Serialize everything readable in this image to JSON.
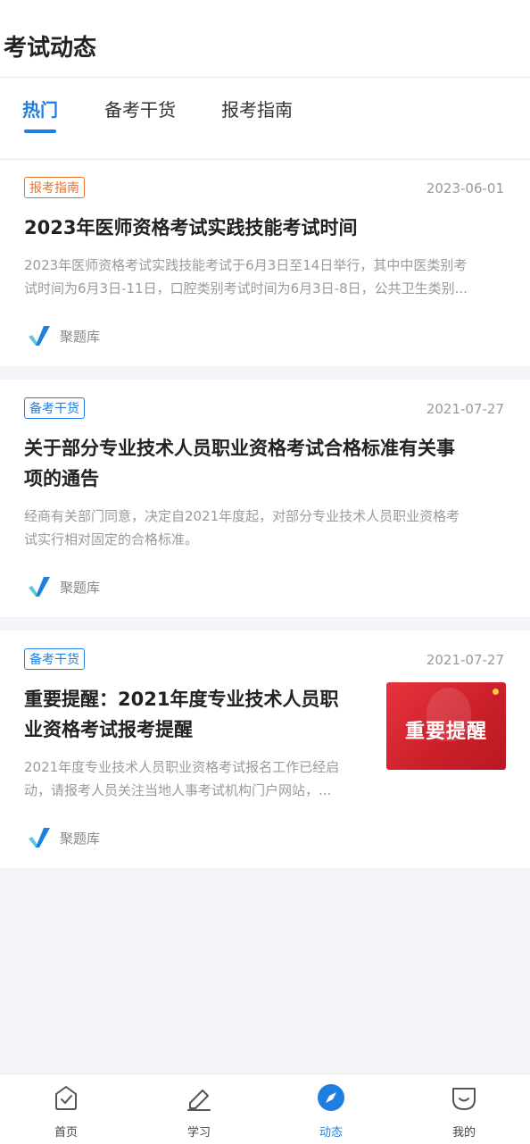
{
  "header": {
    "title": "考试动态"
  },
  "tabs": [
    {
      "label": "热门",
      "active": true
    },
    {
      "label": "备考干货",
      "active": false
    },
    {
      "label": "报考指南",
      "active": false
    }
  ],
  "articles": [
    {
      "tag": "报考指南",
      "date": "2023-06-01",
      "title": "2023年医师资格考试实践技能考试时间",
      "summary_line1": "2023年医师资格考试实践技能考试于6月3日至14日举行，其中中医类别考",
      "summary_line2": "试时间为6月3日-11日，口腔类别考试时间为6月3日-8日，公共卫生类别...",
      "source": "聚题库"
    },
    {
      "tag": "备考干货",
      "date": "2021-07-27",
      "title_line1": "关于部分专业技术人员职业资格考试合格标准有关事",
      "title_line2": "项的通告",
      "summary_line1": "经商有关部门同意，决定自2021年度起，对部分专业技术人员职业资格考",
      "summary_line2": "试实行相对固定的合格标准。",
      "source": "聚题库"
    },
    {
      "tag": "备考干货",
      "date": "2021-07-27",
      "title_line1": "重要提醒：2021年度专业技术人员职",
      "title_line2": "业资格考试报考提醒",
      "summary_line1": "2021年度专业技术人员职业资格考试报名工作已经启",
      "summary_line2": "动，请报考人员关注当地人事考试机构门户网站，...",
      "thumb_text": "重要提醒",
      "source": "聚题库"
    }
  ],
  "nav": [
    {
      "label": "首页",
      "icon": "home-check-icon"
    },
    {
      "label": "学习",
      "icon": "pencil-icon"
    },
    {
      "label": "动态",
      "icon": "compass-icon",
      "active": true
    },
    {
      "label": "我的",
      "icon": "profile-icon"
    }
  ],
  "colors": {
    "accent": "#1f7fe0",
    "tag_orange": "#e8742d"
  }
}
